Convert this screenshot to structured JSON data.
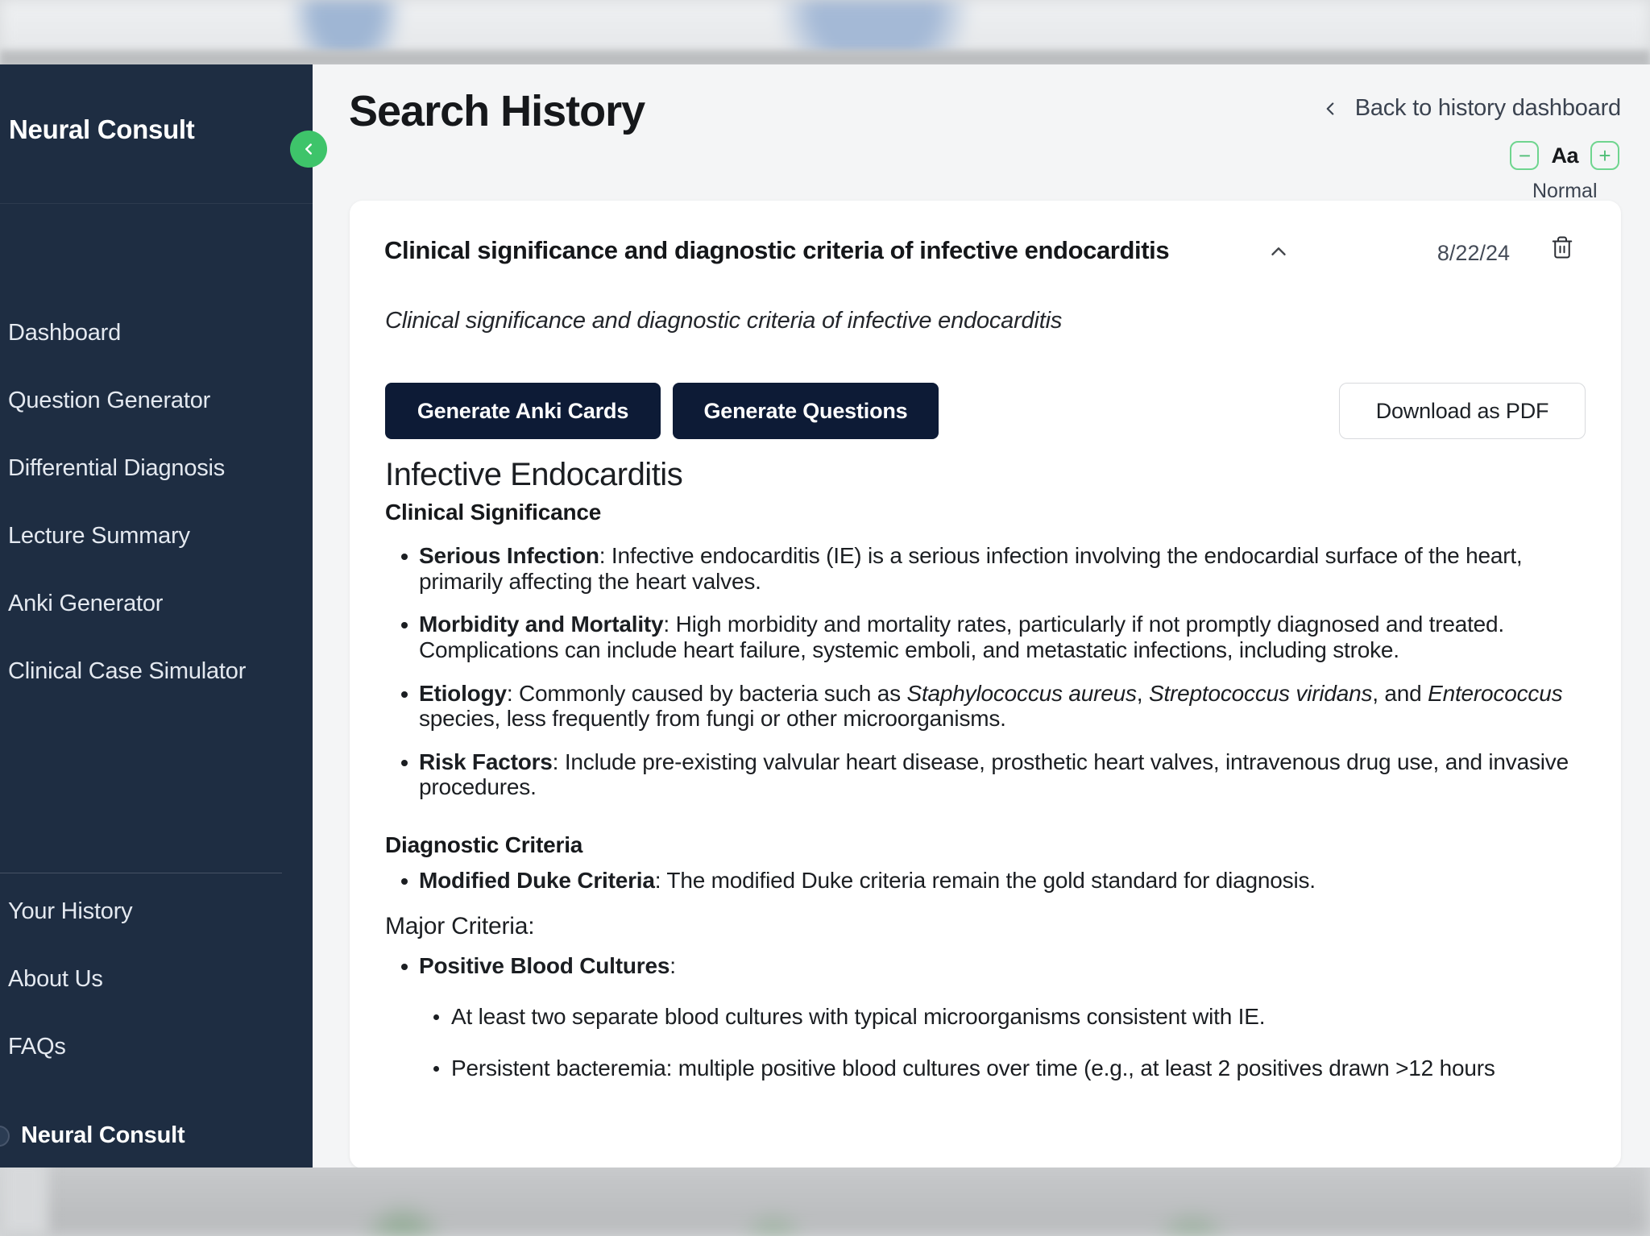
{
  "sidebar": {
    "brand": "Neural Consult",
    "items": [
      {
        "label": "Dashboard",
        "name": "dashboard"
      },
      {
        "label": "Question Generator",
        "name": "question-generator"
      },
      {
        "label": "Differential Diagnosis",
        "name": "differential-diagnosis"
      },
      {
        "label": "Lecture Summary",
        "name": "lecture-summary"
      },
      {
        "label": "Anki Generator",
        "name": "anki-generator"
      },
      {
        "label": "Clinical Case Simulator",
        "name": "clinical-case-simulator"
      },
      {
        "label": "Your History",
        "name": "your-history"
      },
      {
        "label": "About Us",
        "name": "about-us"
      },
      {
        "label": "FAQs",
        "name": "faqs"
      }
    ],
    "footer_label": "Neural Consult",
    "collapse_icon": "chevron-left-icon",
    "accent_color": "#3ec46a",
    "background_color": "#1e2d42"
  },
  "header": {
    "title": "Search History",
    "back_label": "Back to history dashboard",
    "back_icon": "chevron-left-icon"
  },
  "font_controls": {
    "decrease_label": "−",
    "sample_label": "Aa",
    "increase_label": "+",
    "size_name": "Normal",
    "accent_color": "#6fd58f"
  },
  "record": {
    "title": "Clinical significance and diagnostic criteria of infective endocarditis",
    "date": "8/22/24",
    "query": "Clinical significance and diagnostic criteria of infective endocarditis",
    "collapse_icon": "chevron-up-icon",
    "delete_icon": "trash-icon",
    "actions": {
      "anki": "Generate Anki Cards",
      "questions": "Generate Questions",
      "pdf": "Download as PDF"
    }
  },
  "article": {
    "h1": "Infective Endocarditis",
    "section1_heading": "Clinical Significance",
    "bullets1": [
      {
        "term": "Serious Infection",
        "text": ": Infective endocarditis (IE) is a serious infection involving the endocardial surface of the heart, primarily affecting the heart valves."
      },
      {
        "term": "Morbidity and Mortality",
        "text": ": High morbidity and mortality rates, particularly if not promptly diagnosed and treated. Complications can include heart failure, systemic emboli, and metastatic infections, including stroke."
      },
      {
        "term": "Etiology",
        "text_a": ": Commonly caused by bacteria such as ",
        "italic_a": "Staphylococcus aureus",
        "text_b": ", ",
        "italic_b": "Streptococcus viridans",
        "text_c": ", and ",
        "italic_c": "Enterococcus",
        "text_d": " species, less frequently from fungi or other microorganisms."
      },
      {
        "term": "Risk Factors",
        "text": ": Include pre-existing valvular heart disease, prosthetic heart valves, intravenous drug use, and invasive procedures."
      }
    ],
    "section2_heading": "Diagnostic Criteria",
    "bullets2": [
      {
        "term": "Modified Duke Criteria",
        "text": ": The modified Duke criteria remain the gold standard for diagnosis."
      }
    ],
    "major_criteria_label": "Major Criteria:",
    "bullets3": [
      {
        "term": "Positive Blood Cultures",
        "text": ":"
      }
    ],
    "sub_bullets": [
      "At least two separate blood cultures with typical microorganisms consistent with IE.",
      "Persistent bacteremia: multiple positive blood cultures over time (e.g., at least 2 positives drawn >12 hours"
    ]
  }
}
